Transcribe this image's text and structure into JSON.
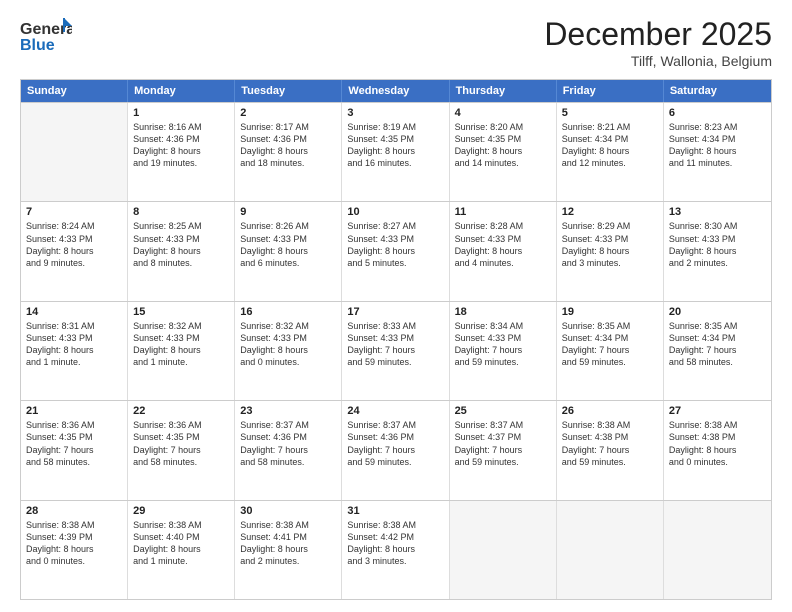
{
  "header": {
    "logo_general": "General",
    "logo_blue": "Blue",
    "month": "December 2025",
    "location": "Tilff, Wallonia, Belgium"
  },
  "calendar": {
    "days": [
      "Sunday",
      "Monday",
      "Tuesday",
      "Wednesday",
      "Thursday",
      "Friday",
      "Saturday"
    ],
    "rows": [
      [
        {
          "day": "",
          "lines": []
        },
        {
          "day": "1",
          "lines": [
            "Sunrise: 8:16 AM",
            "Sunset: 4:36 PM",
            "Daylight: 8 hours",
            "and 19 minutes."
          ]
        },
        {
          "day": "2",
          "lines": [
            "Sunrise: 8:17 AM",
            "Sunset: 4:36 PM",
            "Daylight: 8 hours",
            "and 18 minutes."
          ]
        },
        {
          "day": "3",
          "lines": [
            "Sunrise: 8:19 AM",
            "Sunset: 4:35 PM",
            "Daylight: 8 hours",
            "and 16 minutes."
          ]
        },
        {
          "day": "4",
          "lines": [
            "Sunrise: 8:20 AM",
            "Sunset: 4:35 PM",
            "Daylight: 8 hours",
            "and 14 minutes."
          ]
        },
        {
          "day": "5",
          "lines": [
            "Sunrise: 8:21 AM",
            "Sunset: 4:34 PM",
            "Daylight: 8 hours",
            "and 12 minutes."
          ]
        },
        {
          "day": "6",
          "lines": [
            "Sunrise: 8:23 AM",
            "Sunset: 4:34 PM",
            "Daylight: 8 hours",
            "and 11 minutes."
          ]
        }
      ],
      [
        {
          "day": "7",
          "lines": [
            "Sunrise: 8:24 AM",
            "Sunset: 4:33 PM",
            "Daylight: 8 hours",
            "and 9 minutes."
          ]
        },
        {
          "day": "8",
          "lines": [
            "Sunrise: 8:25 AM",
            "Sunset: 4:33 PM",
            "Daylight: 8 hours",
            "and 8 minutes."
          ]
        },
        {
          "day": "9",
          "lines": [
            "Sunrise: 8:26 AM",
            "Sunset: 4:33 PM",
            "Daylight: 8 hours",
            "and 6 minutes."
          ]
        },
        {
          "day": "10",
          "lines": [
            "Sunrise: 8:27 AM",
            "Sunset: 4:33 PM",
            "Daylight: 8 hours",
            "and 5 minutes."
          ]
        },
        {
          "day": "11",
          "lines": [
            "Sunrise: 8:28 AM",
            "Sunset: 4:33 PM",
            "Daylight: 8 hours",
            "and 4 minutes."
          ]
        },
        {
          "day": "12",
          "lines": [
            "Sunrise: 8:29 AM",
            "Sunset: 4:33 PM",
            "Daylight: 8 hours",
            "and 3 minutes."
          ]
        },
        {
          "day": "13",
          "lines": [
            "Sunrise: 8:30 AM",
            "Sunset: 4:33 PM",
            "Daylight: 8 hours",
            "and 2 minutes."
          ]
        }
      ],
      [
        {
          "day": "14",
          "lines": [
            "Sunrise: 8:31 AM",
            "Sunset: 4:33 PM",
            "Daylight: 8 hours",
            "and 1 minute."
          ]
        },
        {
          "day": "15",
          "lines": [
            "Sunrise: 8:32 AM",
            "Sunset: 4:33 PM",
            "Daylight: 8 hours",
            "and 1 minute."
          ]
        },
        {
          "day": "16",
          "lines": [
            "Sunrise: 8:32 AM",
            "Sunset: 4:33 PM",
            "Daylight: 8 hours",
            "and 0 minutes."
          ]
        },
        {
          "day": "17",
          "lines": [
            "Sunrise: 8:33 AM",
            "Sunset: 4:33 PM",
            "Daylight: 7 hours",
            "and 59 minutes."
          ]
        },
        {
          "day": "18",
          "lines": [
            "Sunrise: 8:34 AM",
            "Sunset: 4:33 PM",
            "Daylight: 7 hours",
            "and 59 minutes."
          ]
        },
        {
          "day": "19",
          "lines": [
            "Sunrise: 8:35 AM",
            "Sunset: 4:34 PM",
            "Daylight: 7 hours",
            "and 59 minutes."
          ]
        },
        {
          "day": "20",
          "lines": [
            "Sunrise: 8:35 AM",
            "Sunset: 4:34 PM",
            "Daylight: 7 hours",
            "and 58 minutes."
          ]
        }
      ],
      [
        {
          "day": "21",
          "lines": [
            "Sunrise: 8:36 AM",
            "Sunset: 4:35 PM",
            "Daylight: 7 hours",
            "and 58 minutes."
          ]
        },
        {
          "day": "22",
          "lines": [
            "Sunrise: 8:36 AM",
            "Sunset: 4:35 PM",
            "Daylight: 7 hours",
            "and 58 minutes."
          ]
        },
        {
          "day": "23",
          "lines": [
            "Sunrise: 8:37 AM",
            "Sunset: 4:36 PM",
            "Daylight: 7 hours",
            "and 58 minutes."
          ]
        },
        {
          "day": "24",
          "lines": [
            "Sunrise: 8:37 AM",
            "Sunset: 4:36 PM",
            "Daylight: 7 hours",
            "and 59 minutes."
          ]
        },
        {
          "day": "25",
          "lines": [
            "Sunrise: 8:37 AM",
            "Sunset: 4:37 PM",
            "Daylight: 7 hours",
            "and 59 minutes."
          ]
        },
        {
          "day": "26",
          "lines": [
            "Sunrise: 8:38 AM",
            "Sunset: 4:38 PM",
            "Daylight: 7 hours",
            "and 59 minutes."
          ]
        },
        {
          "day": "27",
          "lines": [
            "Sunrise: 8:38 AM",
            "Sunset: 4:38 PM",
            "Daylight: 8 hours",
            "and 0 minutes."
          ]
        }
      ],
      [
        {
          "day": "28",
          "lines": [
            "Sunrise: 8:38 AM",
            "Sunset: 4:39 PM",
            "Daylight: 8 hours",
            "and 0 minutes."
          ]
        },
        {
          "day": "29",
          "lines": [
            "Sunrise: 8:38 AM",
            "Sunset: 4:40 PM",
            "Daylight: 8 hours",
            "and 1 minute."
          ]
        },
        {
          "day": "30",
          "lines": [
            "Sunrise: 8:38 AM",
            "Sunset: 4:41 PM",
            "Daylight: 8 hours",
            "and 2 minutes."
          ]
        },
        {
          "day": "31",
          "lines": [
            "Sunrise: 8:38 AM",
            "Sunset: 4:42 PM",
            "Daylight: 8 hours",
            "and 3 minutes."
          ]
        },
        {
          "day": "",
          "lines": []
        },
        {
          "day": "",
          "lines": []
        },
        {
          "day": "",
          "lines": []
        }
      ]
    ]
  }
}
